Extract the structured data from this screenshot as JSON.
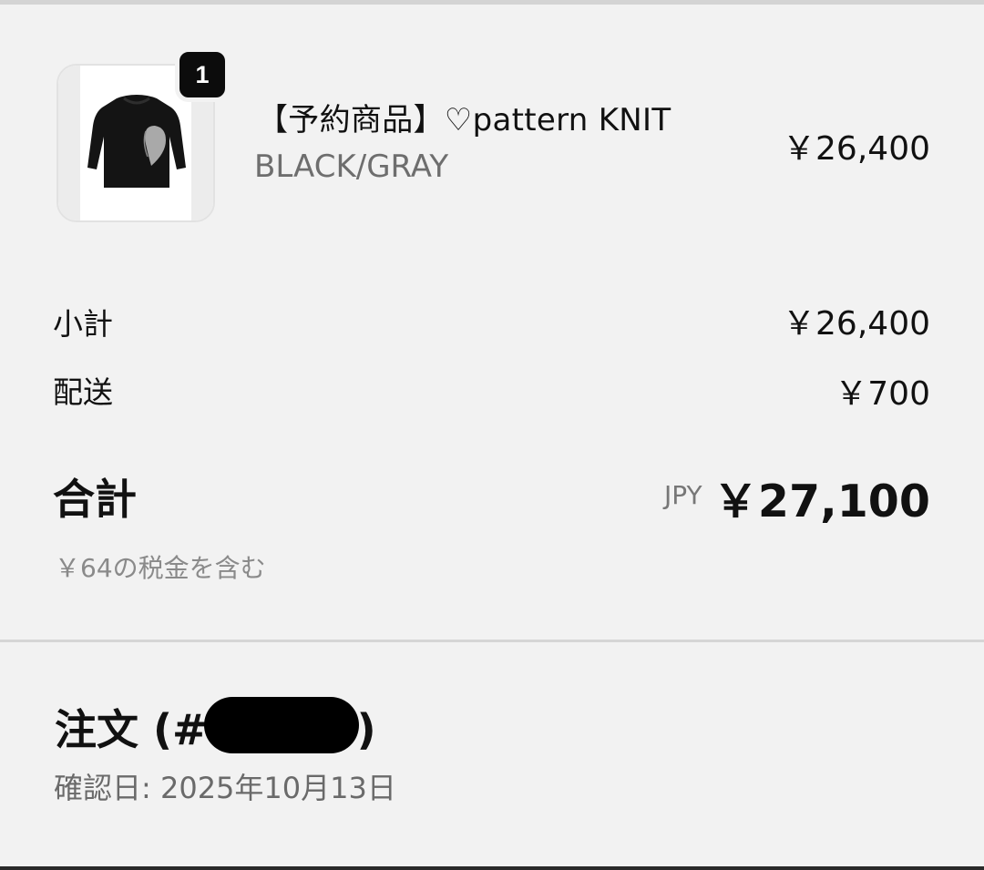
{
  "product": {
    "quantity": "1",
    "name": "【予約商品】♡pattern KNIT",
    "variant": "BLACK/GRAY",
    "price": "￥26,400",
    "image_icon": "knit-sweater-icon"
  },
  "summary": {
    "subtotal_label": "小計",
    "subtotal_value": "￥26,400",
    "shipping_label": "配送",
    "shipping_value": "￥700",
    "total_label": "合計",
    "currency": "JPY",
    "total_value": "￥27,100",
    "tax_note": "￥64の税金を含む"
  },
  "order": {
    "title_prefix": "注文 (#",
    "title_suffix": ")",
    "confirm_label": "確認日:",
    "confirm_date": "2025年10月13日"
  },
  "colors": {
    "background": "#f2f2f2",
    "text": "#111111",
    "muted": "#6e6e6e",
    "badge": "#0c0c0c"
  }
}
